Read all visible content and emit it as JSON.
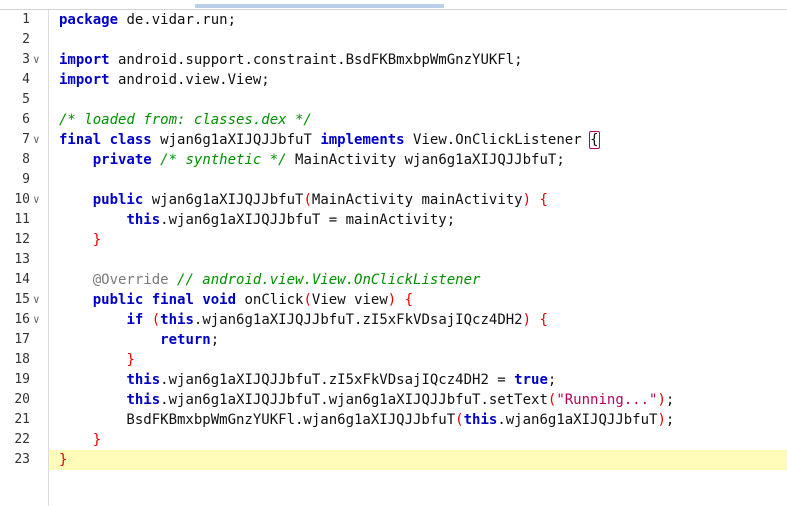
{
  "editor": {
    "lines": [
      {
        "num": "1",
        "fold": false,
        "current": false,
        "tokens": [
          {
            "t": "package",
            "k": "kw"
          },
          {
            "t": " de.vidar.run;",
            "k": "pl"
          }
        ]
      },
      {
        "num": "2",
        "fold": false,
        "current": false,
        "tokens": []
      },
      {
        "num": "3",
        "fold": true,
        "current": false,
        "tokens": [
          {
            "t": "import",
            "k": "kw"
          },
          {
            "t": " android.support.constraint.BsdFKBmxbpWmGnzYUKFl;",
            "k": "pl"
          }
        ]
      },
      {
        "num": "4",
        "fold": false,
        "current": false,
        "tokens": [
          {
            "t": "import",
            "k": "kw"
          },
          {
            "t": " android.view.View;",
            "k": "pl"
          }
        ]
      },
      {
        "num": "5",
        "fold": false,
        "current": false,
        "tokens": []
      },
      {
        "num": "6",
        "fold": false,
        "current": false,
        "tokens": [
          {
            "t": "/* loaded from: classes.dex */",
            "k": "cm"
          }
        ]
      },
      {
        "num": "7",
        "fold": true,
        "current": false,
        "tokens": [
          {
            "t": "final",
            "k": "kw"
          },
          {
            "t": " ",
            "k": "pl"
          },
          {
            "t": "class",
            "k": "kw"
          },
          {
            "t": " wjan6g1aXIJQJJbfuT ",
            "k": "pl"
          },
          {
            "t": "implements",
            "k": "kw"
          },
          {
            "t": " View.OnClickListener ",
            "k": "pl"
          },
          {
            "t": "{",
            "k": "br"
          }
        ]
      },
      {
        "num": "8",
        "fold": false,
        "current": false,
        "tokens": [
          {
            "t": "    ",
            "k": "pl"
          },
          {
            "t": "private",
            "k": "kw"
          },
          {
            "t": " ",
            "k": "pl"
          },
          {
            "t": "/* synthetic */",
            "k": "cm"
          },
          {
            "t": " MainActivity wjan6g1aXIJQJJbfuT;",
            "k": "pl"
          }
        ]
      },
      {
        "num": "9",
        "fold": false,
        "current": false,
        "tokens": []
      },
      {
        "num": "10",
        "fold": true,
        "current": false,
        "tokens": [
          {
            "t": "    ",
            "k": "pl"
          },
          {
            "t": "public",
            "k": "kw"
          },
          {
            "t": " wjan6g1aXIJQJJbfuT",
            "k": "pl"
          },
          {
            "t": "(",
            "k": "pn"
          },
          {
            "t": "MainActivity mainActivity",
            "k": "pl"
          },
          {
            "t": ")",
            "k": "pn"
          },
          {
            "t": " ",
            "k": "pl"
          },
          {
            "t": "{",
            "k": "pn"
          }
        ]
      },
      {
        "num": "11",
        "fold": false,
        "current": false,
        "tokens": [
          {
            "t": "        ",
            "k": "pl"
          },
          {
            "t": "this",
            "k": "kw"
          },
          {
            "t": ".wjan6g1aXIJQJJbfuT = mainActivity;",
            "k": "pl"
          }
        ]
      },
      {
        "num": "12",
        "fold": false,
        "current": false,
        "tokens": [
          {
            "t": "    ",
            "k": "pl"
          },
          {
            "t": "}",
            "k": "pn"
          }
        ]
      },
      {
        "num": "13",
        "fold": false,
        "current": false,
        "tokens": []
      },
      {
        "num": "14",
        "fold": false,
        "current": false,
        "tokens": [
          {
            "t": "    ",
            "k": "pl"
          },
          {
            "t": "@Override",
            "k": "an"
          },
          {
            "t": " ",
            "k": "pl"
          },
          {
            "t": "// android.view.View.OnClickListener",
            "k": "cm"
          }
        ]
      },
      {
        "num": "15",
        "fold": true,
        "current": false,
        "tokens": [
          {
            "t": "    ",
            "k": "pl"
          },
          {
            "t": "public",
            "k": "kw"
          },
          {
            "t": " ",
            "k": "pl"
          },
          {
            "t": "final",
            "k": "kw"
          },
          {
            "t": " ",
            "k": "pl"
          },
          {
            "t": "void",
            "k": "kw"
          },
          {
            "t": " onClick",
            "k": "pl"
          },
          {
            "t": "(",
            "k": "pn"
          },
          {
            "t": "View view",
            "k": "pl"
          },
          {
            "t": ")",
            "k": "pn"
          },
          {
            "t": " ",
            "k": "pl"
          },
          {
            "t": "{",
            "k": "pn"
          }
        ]
      },
      {
        "num": "16",
        "fold": true,
        "current": false,
        "tokens": [
          {
            "t": "        ",
            "k": "pl"
          },
          {
            "t": "if",
            "k": "kw"
          },
          {
            "t": " ",
            "k": "pl"
          },
          {
            "t": "(",
            "k": "pn"
          },
          {
            "t": "this",
            "k": "kw"
          },
          {
            "t": ".wjan6g1aXIJQJJbfuT.zI5xFkVDsajIQcz4DH2",
            "k": "pl"
          },
          {
            "t": ")",
            "k": "pn"
          },
          {
            "t": " ",
            "k": "pl"
          },
          {
            "t": "{",
            "k": "pn"
          }
        ]
      },
      {
        "num": "17",
        "fold": false,
        "current": false,
        "tokens": [
          {
            "t": "            ",
            "k": "pl"
          },
          {
            "t": "return",
            "k": "kw"
          },
          {
            "t": ";",
            "k": "pl"
          }
        ]
      },
      {
        "num": "18",
        "fold": false,
        "current": false,
        "tokens": [
          {
            "t": "        ",
            "k": "pl"
          },
          {
            "t": "}",
            "k": "pn"
          }
        ]
      },
      {
        "num": "19",
        "fold": false,
        "current": false,
        "tokens": [
          {
            "t": "        ",
            "k": "pl"
          },
          {
            "t": "this",
            "k": "kw"
          },
          {
            "t": ".wjan6g1aXIJQJJbfuT.zI5xFkVDsajIQcz4DH2 = ",
            "k": "pl"
          },
          {
            "t": "true",
            "k": "kw"
          },
          {
            "t": ";",
            "k": "pl"
          }
        ]
      },
      {
        "num": "20",
        "fold": false,
        "current": false,
        "tokens": [
          {
            "t": "        ",
            "k": "pl"
          },
          {
            "t": "this",
            "k": "kw"
          },
          {
            "t": ".wjan6g1aXIJQJJbfuT.wjan6g1aXIJQJJbfuT.setText",
            "k": "pl"
          },
          {
            "t": "(",
            "k": "pn"
          },
          {
            "t": "\"Running...\"",
            "k": "st"
          },
          {
            "t": ")",
            "k": "pn"
          },
          {
            "t": ";",
            "k": "pl"
          }
        ]
      },
      {
        "num": "21",
        "fold": false,
        "current": false,
        "tokens": [
          {
            "t": "        BsdFKBmxbpWmGnzYUKFl.wjan6g1aXIJQJJbfuT",
            "k": "pl"
          },
          {
            "t": "(",
            "k": "pn"
          },
          {
            "t": "this",
            "k": "kw"
          },
          {
            "t": ".wjan6g1aXIJQJJbfuT",
            "k": "pl"
          },
          {
            "t": ")",
            "k": "pn"
          },
          {
            "t": ";",
            "k": "pl"
          }
        ]
      },
      {
        "num": "22",
        "fold": false,
        "current": false,
        "tokens": [
          {
            "t": "    ",
            "k": "pl"
          },
          {
            "t": "}",
            "k": "pn"
          }
        ]
      },
      {
        "num": "23",
        "fold": false,
        "current": true,
        "tokens": [
          {
            "t": "}",
            "k": "pn"
          }
        ]
      }
    ]
  }
}
